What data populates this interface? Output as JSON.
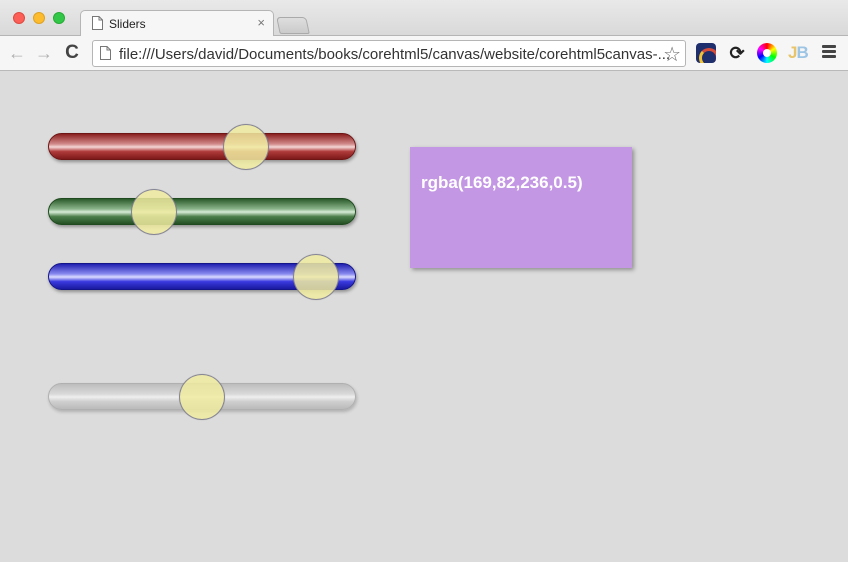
{
  "window": {
    "tab_title": "Sliders",
    "tab_close": "×"
  },
  "toolbar": {
    "back_icon": "←",
    "forward_icon": "→",
    "reload_icon": "C",
    "url": "file:///Users/david/Documents/books/corehtml5/canvas/website/corehtml5canvas-...",
    "bookmark_icon": "☆",
    "extensions": [
      "speed-gauge-icon",
      "sync-icon",
      "color-wheel-icon",
      "jb-icon"
    ],
    "jb_label": "JB"
  },
  "sliders": [
    {
      "name": "red",
      "value": 169,
      "max": 255,
      "color": "#b03a3a"
    },
    {
      "name": "green",
      "value": 82,
      "max": 255,
      "color": "#4c7f4c"
    },
    {
      "name": "blue",
      "value": 236,
      "max": 255,
      "color": "#3a3ae0"
    },
    {
      "name": "alpha",
      "value": 0.5,
      "max": 1,
      "color": "#cfcfcf"
    }
  ],
  "color_swatch": {
    "label": "rgba(169,82,236,0.5)",
    "color": "rgba(169,82,236,0.5)"
  }
}
